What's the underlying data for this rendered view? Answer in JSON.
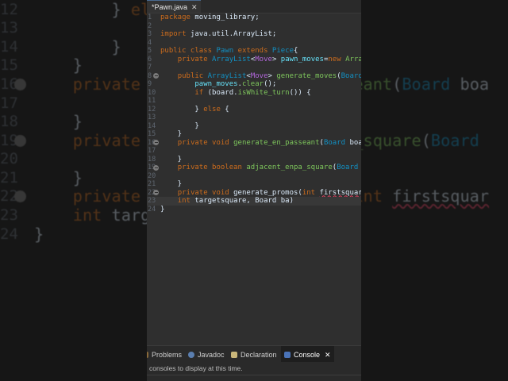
{
  "editor_tab": {
    "label": "*Pawn.java",
    "close": "✕"
  },
  "code_lines": [
    {
      "n": "1",
      "tokens": [
        [
          "k",
          "package"
        ],
        [
          "p",
          " moving_library;"
        ]
      ]
    },
    {
      "n": "2",
      "tokens": []
    },
    {
      "n": "3",
      "tokens": [
        [
          "k",
          "import"
        ],
        [
          "p",
          " java.util.ArrayList;"
        ]
      ]
    },
    {
      "n": "4",
      "tokens": []
    },
    {
      "n": "5",
      "tokens": [
        [
          "k",
          "public class"
        ],
        [
          "p",
          " "
        ],
        [
          "t",
          "Pawn"
        ],
        [
          "p",
          " "
        ],
        [
          "k",
          "extends"
        ],
        [
          "p",
          " "
        ],
        [
          "t",
          "Piece"
        ],
        [
          "p",
          "{"
        ]
      ]
    },
    {
      "n": "6",
      "tokens": [
        [
          "p",
          "    "
        ],
        [
          "k",
          "private"
        ],
        [
          "p",
          " "
        ],
        [
          "t",
          "ArrayList"
        ],
        [
          "p",
          "<"
        ],
        [
          "g",
          "Move"
        ],
        [
          "p",
          "> "
        ],
        [
          "f",
          "pawn_moves"
        ],
        [
          "p",
          "="
        ],
        [
          "k",
          "new"
        ],
        [
          "p",
          " "
        ],
        [
          "m",
          "Arra"
        ]
      ]
    },
    {
      "n": "7",
      "tokens": []
    },
    {
      "n": "8",
      "fold": true,
      "tokens": [
        [
          "p",
          "    "
        ],
        [
          "k",
          "public"
        ],
        [
          "p",
          " "
        ],
        [
          "t",
          "ArrayList"
        ],
        [
          "p",
          "<"
        ],
        [
          "g",
          "Move"
        ],
        [
          "p",
          "> "
        ],
        [
          "m",
          "generate_moves"
        ],
        [
          "p",
          "("
        ],
        [
          "t",
          "Board"
        ]
      ]
    },
    {
      "n": "9",
      "tokens": [
        [
          "p",
          "        "
        ],
        [
          "f",
          "pawn_moves"
        ],
        [
          "p",
          "."
        ],
        [
          "m",
          "clear"
        ],
        [
          "p",
          "();"
        ]
      ]
    },
    {
      "n": "10",
      "tokens": [
        [
          "p",
          "        "
        ],
        [
          "k",
          "if"
        ],
        [
          "p",
          " ("
        ],
        [
          "p",
          "board"
        ],
        [
          "p",
          "."
        ],
        [
          "m",
          "isWhite_turn"
        ],
        [
          "p",
          "()) {"
        ]
      ]
    },
    {
      "n": "11",
      "tokens": []
    },
    {
      "n": "12",
      "tokens": [
        [
          "p",
          "        } "
        ],
        [
          "k",
          "else"
        ],
        [
          "p",
          " {"
        ]
      ]
    },
    {
      "n": "13",
      "tokens": []
    },
    {
      "n": "14",
      "tokens": [
        [
          "p",
          "        }"
        ]
      ]
    },
    {
      "n": "15",
      "tokens": [
        [
          "p",
          "    }"
        ]
      ]
    },
    {
      "n": "16",
      "fold": true,
      "tokens": [
        [
          "p",
          "    "
        ],
        [
          "k",
          "private void"
        ],
        [
          "p",
          " "
        ],
        [
          "m",
          "generate_en_passeant"
        ],
        [
          "p",
          "("
        ],
        [
          "t",
          "Board"
        ],
        [
          "p",
          " boa"
        ]
      ]
    },
    {
      "n": "17",
      "tokens": []
    },
    {
      "n": "18",
      "tokens": [
        [
          "p",
          "    }"
        ]
      ]
    },
    {
      "n": "19",
      "fold": true,
      "tokens": [
        [
          "p",
          "    "
        ],
        [
          "k",
          "private boolean"
        ],
        [
          "p",
          " "
        ],
        [
          "m",
          "adjacent_enpa_square"
        ],
        [
          "p",
          "("
        ],
        [
          "t",
          "Board"
        ]
      ]
    },
    {
      "n": "20",
      "tokens": []
    },
    {
      "n": "21",
      "tokens": [
        [
          "p",
          "    }"
        ]
      ]
    },
    {
      "n": "22",
      "fold": true,
      "tokens": [
        [
          "p",
          "    "
        ],
        [
          "k",
          "private void"
        ],
        [
          "p",
          " generate_promos("
        ],
        [
          "k",
          "int"
        ],
        [
          "p",
          " "
        ],
        [
          "e",
          "firstsquar"
        ]
      ]
    },
    {
      "n": "23",
      "current": true,
      "tokens": [
        [
          "p",
          "    "
        ],
        [
          "k",
          "int"
        ],
        [
          "p",
          " targetsquare, Board ba)"
        ]
      ]
    },
    {
      "n": "24",
      "tokens": [
        [
          "p",
          "}"
        ]
      ]
    }
  ],
  "bottom_panel": {
    "tabs": [
      {
        "label": "Problems",
        "icon": "problems-icon"
      },
      {
        "label": "Javadoc",
        "icon": "javadoc-icon"
      },
      {
        "label": "Declaration",
        "icon": "declaration-icon"
      },
      {
        "label": "Console",
        "icon": "console-icon",
        "active": true,
        "close": "✕"
      }
    ],
    "message": "consoles to display at this time."
  }
}
